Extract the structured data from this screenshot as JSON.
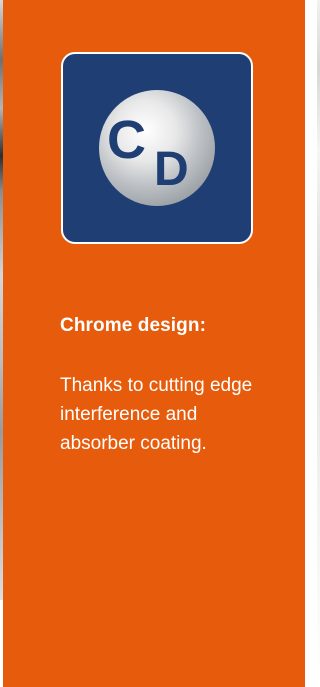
{
  "logo": {
    "letters": "CD",
    "letter_c": "C",
    "letter_d": "D",
    "card_color": "#1f3e73",
    "accent_color": "#e65c0c"
  },
  "heading": "Chrome design:",
  "description": "Thanks to cutting edge interference and absorber coating."
}
